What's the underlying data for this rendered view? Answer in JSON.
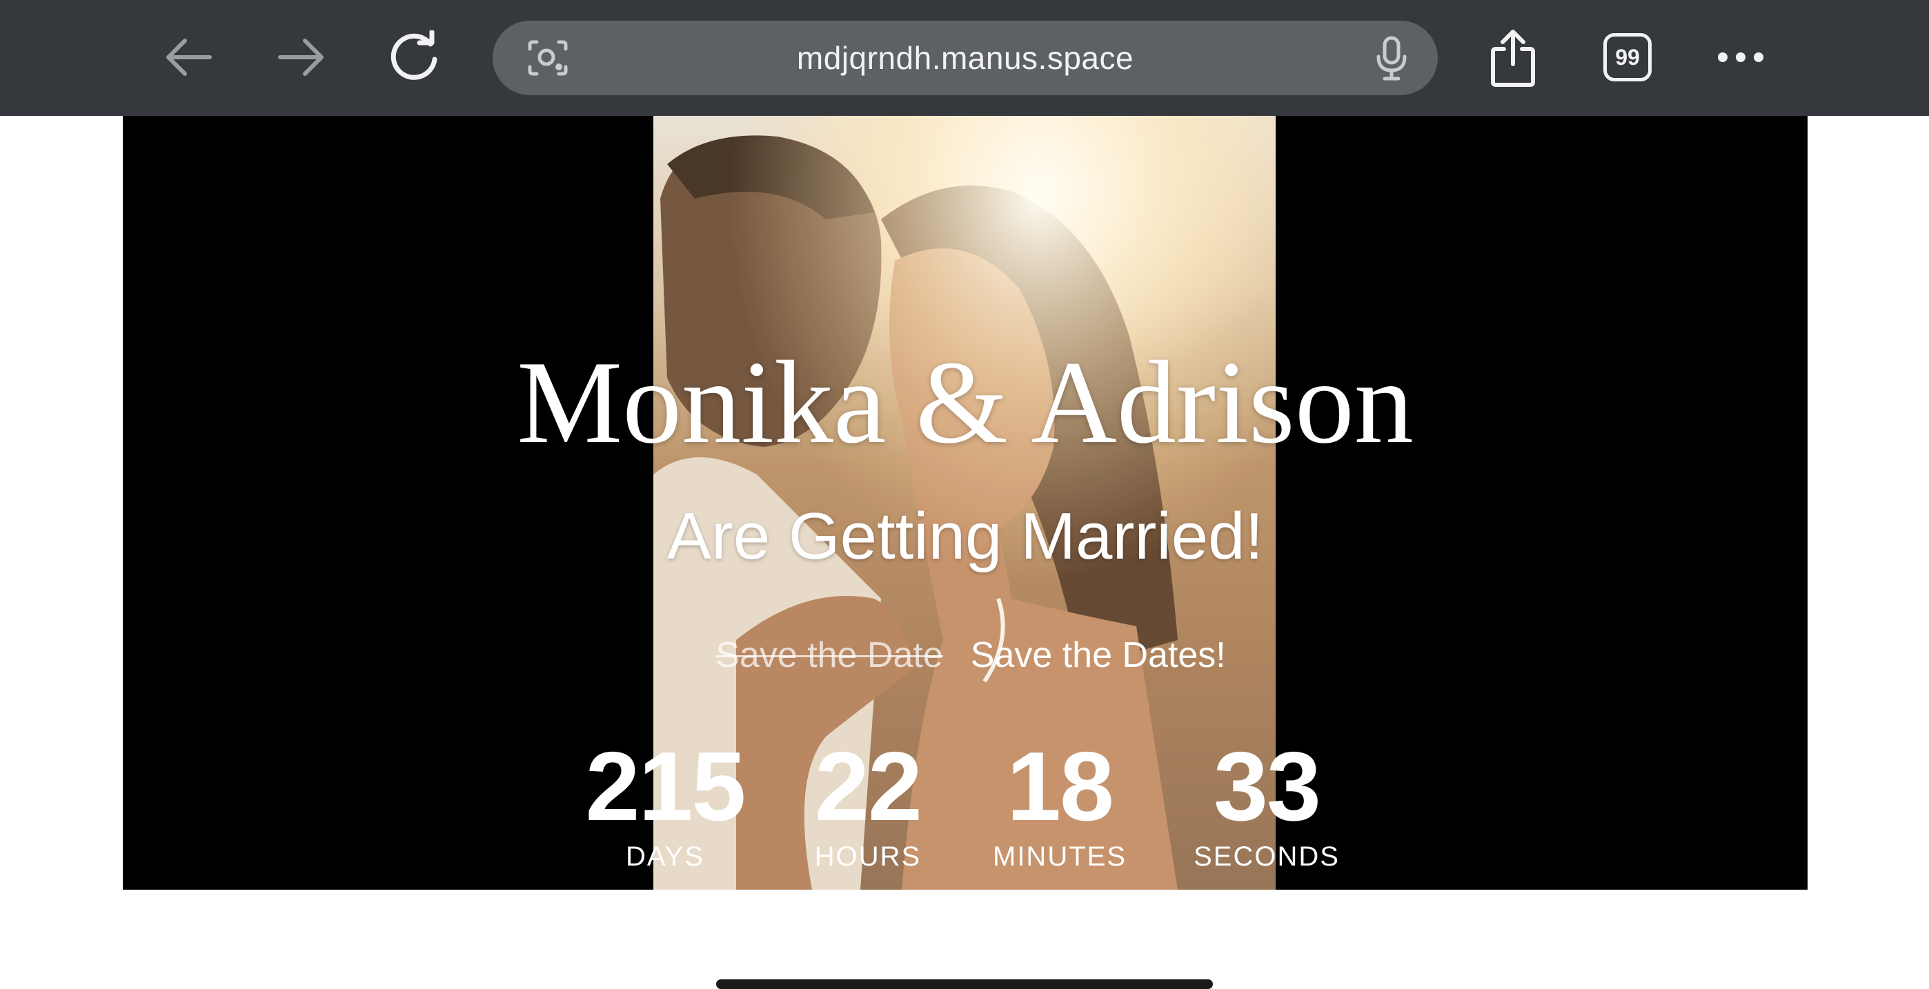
{
  "browser": {
    "url": "mdjqrndh.manus.space",
    "tab_count": "99",
    "icons": {
      "back": "arrow-left-icon",
      "forward": "arrow-right-icon",
      "reload": "reload-icon",
      "lens": "camera-search-icon",
      "mic": "microphone-icon",
      "share": "share-icon",
      "tabs": "tabs-icon",
      "more": "more-dots-icon"
    },
    "colors": {
      "toolbar": "#35393d",
      "url_bar": "#5d6165"
    }
  },
  "hero": {
    "names": "Monika & Adrison",
    "subtitle": "Are Getting Married!",
    "save_old": "Save the Date",
    "save_new": "Save the Dates!",
    "countdown": {
      "days": "215",
      "days_label": "DAYS",
      "hours": "22",
      "hours_label": "HOURS",
      "minutes": "18",
      "minutes_label": "MINUTES",
      "seconds": "33",
      "seconds_label": "SECONDS"
    }
  }
}
